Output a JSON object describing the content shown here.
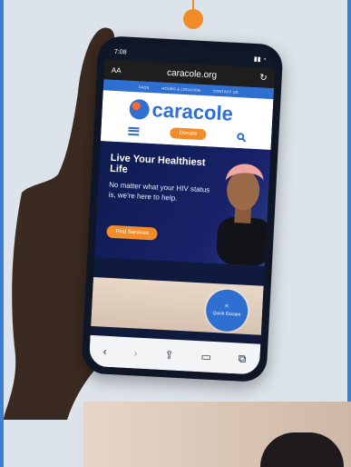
{
  "browser": {
    "time": "7:08",
    "text_size": "AA",
    "url": "caracole.org",
    "reload_icon": "reload-icon"
  },
  "site": {
    "top_nav": [
      "FAQS",
      "HOURS & LOCATION",
      "CONTACT US"
    ],
    "logo_text": "caracole",
    "donate_label": "Donate",
    "hero_title": "Live Your Healthiest Life",
    "hero_body": "No matter what your HIV status is, we're here to help.",
    "find_services_label": "Find Services",
    "quick_escape_label": "Quick Escape"
  },
  "toolbar_icons": [
    "back-icon",
    "forward-icon",
    "share-icon",
    "bookmarks-icon",
    "tabs-icon"
  ],
  "colors": {
    "brand_blue": "#2f6fd2",
    "brand_orange": "#f28c28",
    "hero_navy": "#101a3d"
  }
}
